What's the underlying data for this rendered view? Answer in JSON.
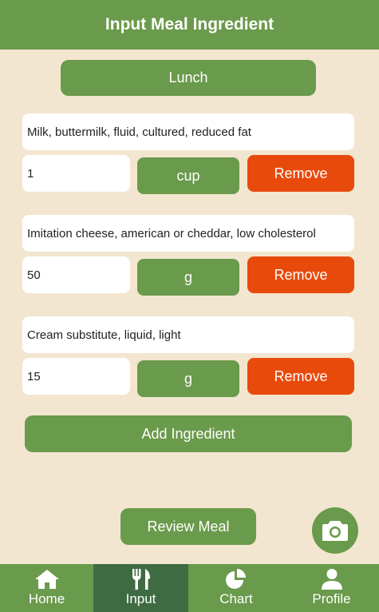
{
  "header": {
    "title": "Input Meal Ingredient"
  },
  "meal": {
    "label": "Lunch"
  },
  "ingredients": [
    {
      "name": "Milk, buttermilk, fluid, cultured, reduced fat",
      "quantity": "1",
      "unit": "cup",
      "remove_label": "Remove"
    },
    {
      "name": "Imitation cheese, american or cheddar, low cholesterol",
      "quantity": "50",
      "unit": "g",
      "remove_label": "Remove"
    },
    {
      "name": "Cream substitute, liquid, light",
      "quantity": "15",
      "unit": "g",
      "remove_label": "Remove"
    }
  ],
  "actions": {
    "add_label": "Add Ingredient",
    "review_label": "Review Meal"
  },
  "nav": {
    "items": [
      {
        "label": "Home",
        "icon": "home-icon"
      },
      {
        "label": "Input",
        "icon": "utensils-icon",
        "active": true
      },
      {
        "label": "Chart",
        "icon": "pie-chart-icon"
      },
      {
        "label": "Profile",
        "icon": "user-icon"
      }
    ]
  },
  "colors": {
    "primary": "#6a9a4b",
    "primary_dark": "#3f6b43",
    "danger": "#e84a0c",
    "background": "#f2e6d0"
  }
}
